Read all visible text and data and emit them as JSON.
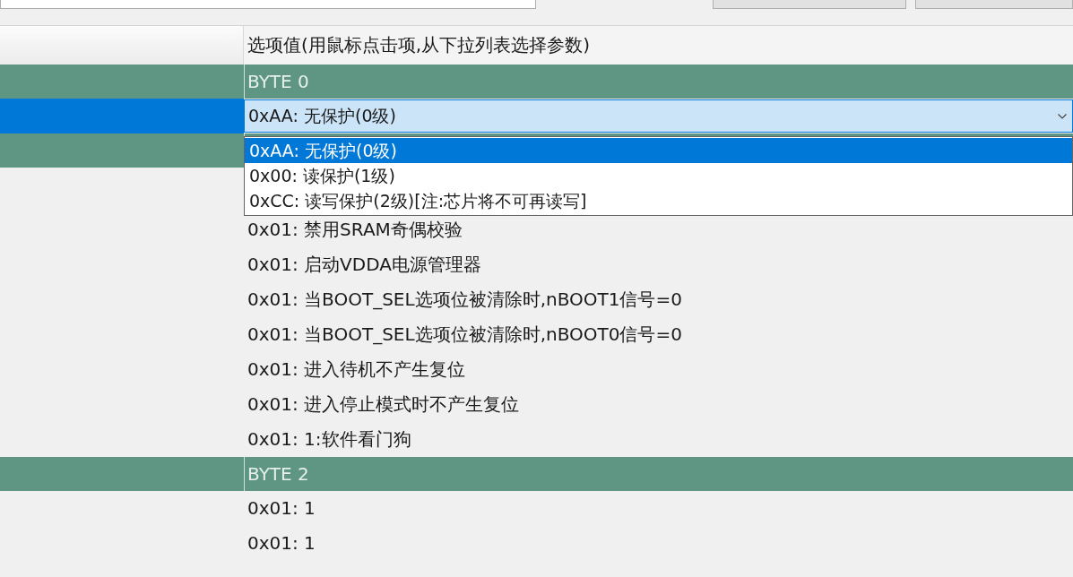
{
  "table": {
    "header": "选项值(用鼠标点击项,从下拉列表选择参数)",
    "rows": [
      {
        "kind": "group",
        "label": "BYTE 0",
        "selected": false
      },
      {
        "kind": "combo",
        "value": "0xAA: 无保护(0级)",
        "selected": true
      },
      {
        "kind": "group",
        "selected": false
      },
      {
        "kind": "value",
        "value": "0x01: 禁用SRAM奇偶校验",
        "selected": false
      },
      {
        "kind": "value",
        "value": "0x01: 启动VDDA电源管理器",
        "selected": false
      },
      {
        "kind": "value",
        "value": "0x01: 当BOOT_SEL选项位被清除时,nBOOT1信号=0",
        "selected": false
      },
      {
        "kind": "value",
        "value": "0x01: 当BOOT_SEL选项位被清除时,nBOOT0信号=0",
        "selected": false
      },
      {
        "kind": "value",
        "value": "0x01: 进入待机不产生复位",
        "selected": false
      },
      {
        "kind": "value",
        "value": "0x01: 进入停止模式时不产生复位",
        "selected": false
      },
      {
        "kind": "value",
        "value": "0x01: 1:软件看门狗",
        "selected": false
      },
      {
        "kind": "group",
        "label": "BYTE 2",
        "selected": false
      },
      {
        "kind": "value",
        "value": "0x01: 1",
        "selected": false
      },
      {
        "kind": "value",
        "value": "0x01: 1",
        "selected": false
      }
    ]
  },
  "dropdown": {
    "options": [
      {
        "label": "0xAA: 无保护(0级)",
        "selected": true
      },
      {
        "label": "0x00: 读保护(1级)",
        "selected": false
      },
      {
        "label": "0xCC: 读写保护(2级)[注:芯片将不可再读写]",
        "selected": false
      }
    ]
  }
}
